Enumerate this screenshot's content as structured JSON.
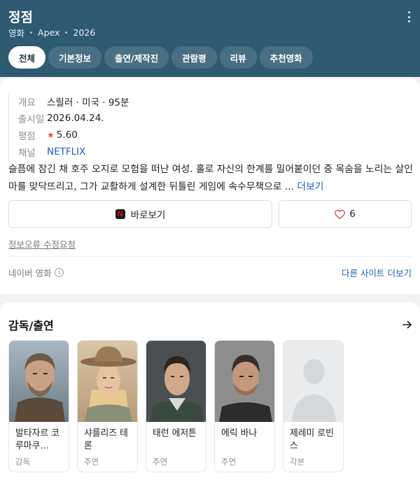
{
  "header": {
    "title": "정점",
    "meta": [
      "영화",
      "Apex",
      "2026"
    ],
    "more_icon": "more-vertical-icon",
    "colors": {
      "background": "#2e5a72",
      "active_tab_bg": "#ffffff"
    }
  },
  "tabs": [
    {
      "label": "전체",
      "active": true
    },
    {
      "label": "기본정보",
      "active": false
    },
    {
      "label": "출연/제작진",
      "active": false
    },
    {
      "label": "관람평",
      "active": false
    },
    {
      "label": "리뷰",
      "active": false
    },
    {
      "label": "추천영화",
      "active": false
    }
  ],
  "info": {
    "overview_label": "개요",
    "overview_value": "스릴러 · 미국 · 95분",
    "release_label": "출시일",
    "release_value": "2026.04.24.",
    "rating_label": "평점",
    "rating_value": "5.60",
    "channel_label": "채널",
    "channel_value": "NETFLIX"
  },
  "synopsis": {
    "text": "슬픔에 잠긴 채 호주 오지로 모험을 떠난 여성. 홀로 자신의 한계를 밀어붙이던 중 목숨을 노리는 살인마를 맞닥뜨리고, 그가 교활하게 설계한 뒤틀린 게임에 속수무책으로 ... ",
    "more_label": "더보기"
  },
  "actions": {
    "watch_label": "바로보기",
    "watch_icon": "netflix-icon",
    "watch_icon_glyph": "N",
    "like_count": "6",
    "like_icon": "heart-icon"
  },
  "footer": {
    "report_label": "정보오류 수정요청",
    "source_label": "네이버 영화",
    "info_icon_glyph": "i",
    "other_sites_label": "다른 사이트 더보기"
  },
  "cast_section": {
    "title": "감독/출연",
    "arrow_icon": "arrow-right-icon",
    "people": [
      {
        "name": "발타자르 코루마쿠...",
        "role": "감독",
        "photo": "director-photo"
      },
      {
        "name": "샤를리즈 테론",
        "role": "주연",
        "photo": "actor-photo"
      },
      {
        "name": "태런 에저튼",
        "role": "주연",
        "photo": "actor-photo"
      },
      {
        "name": "에릭 바나",
        "role": "주연",
        "photo": "actor-photo"
      },
      {
        "name": "제레미 로빈스",
        "role": "각본",
        "photo": "placeholder-person-icon"
      }
    ]
  }
}
